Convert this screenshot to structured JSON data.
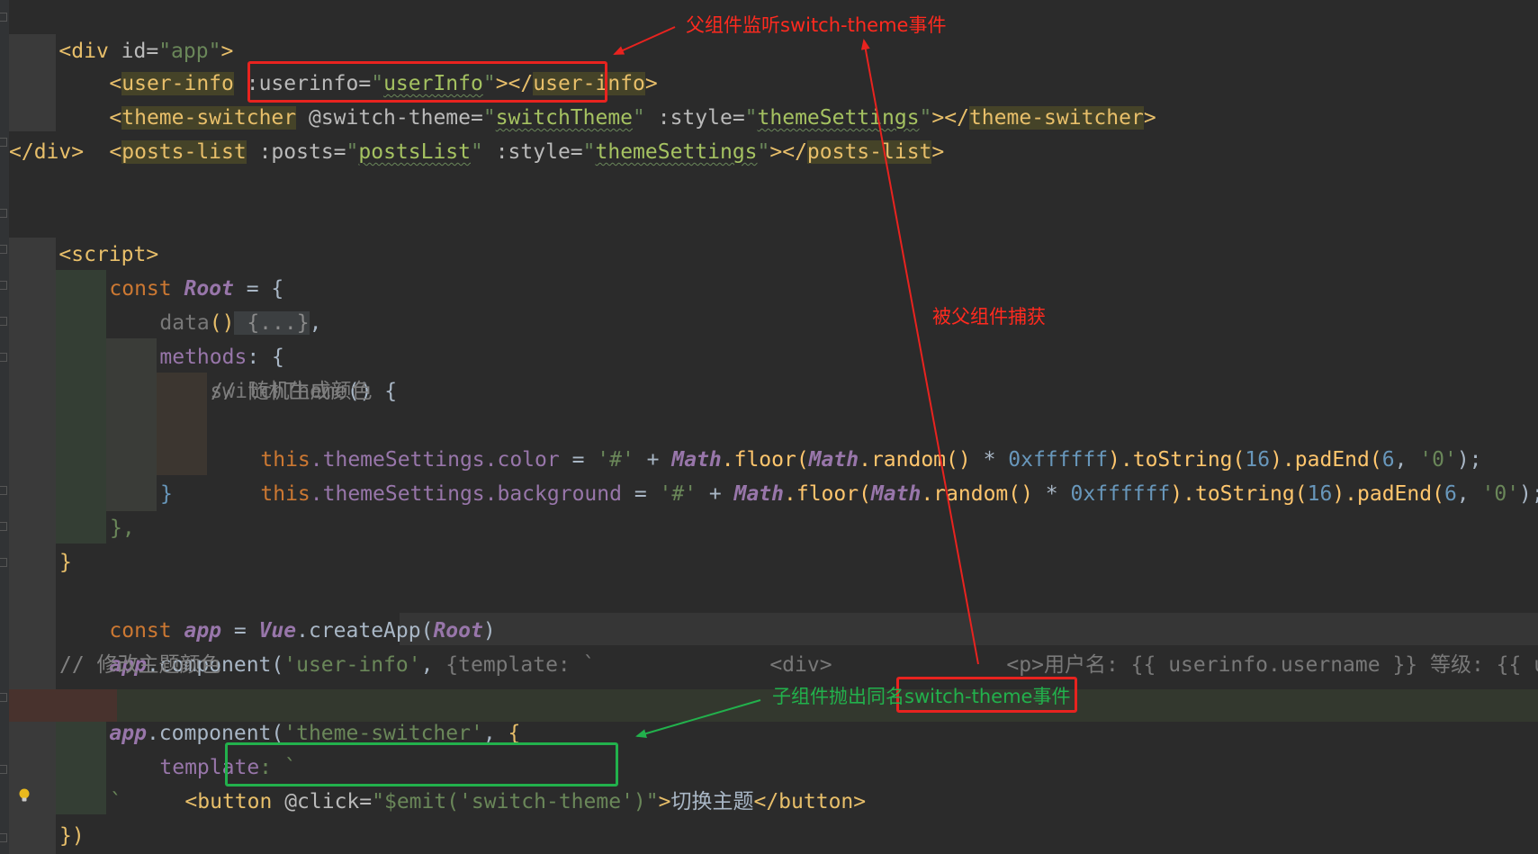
{
  "code": {
    "l1": {
      "open": "<",
      "tag": "div",
      "attr": " id=",
      "val": "\"app\"",
      "close": ">"
    },
    "l2": {
      "lt": "<",
      "tag": "user-info",
      "attr": " :userinfo=",
      "q1": "\"",
      "val": "userInfo",
      "q2": "\"",
      "mid": "></",
      "tag2": "user-info",
      "gt": ">"
    },
    "l3": {
      "lt": "<",
      "tag": "theme-switcher",
      "attr": " @switch-theme=",
      "q1": "\"",
      "val": "switchTheme",
      "q2": "\"",
      "attr2": " :style=",
      "q3": "\"",
      "val2": "themeSettings",
      "q4": "\"",
      "mid": "></",
      "tag2": "theme-switcher",
      "gt": ">"
    },
    "l4": {
      "lt": "<",
      "tag": "posts-list",
      "attr": " :posts=",
      "q1": "\"",
      "val": "postsList",
      "q2": "\"",
      "attr2": " :style=",
      "q3": "\"",
      "val2": "themeSettings",
      "q4": "\"",
      "mid": "></",
      "tag2": "posts-list",
      "gt": ">"
    },
    "l5": {
      "text": "</div>"
    },
    "l7": {
      "lt": "<",
      "tag": "script",
      "gt": ">"
    },
    "l8": {
      "kw": "const ",
      "name": "Root",
      "rest": " = {"
    },
    "l9": {
      "fn": "data",
      "paren": "()",
      "fold": " {...}",
      "comma": ","
    },
    "l10": {
      "fn": "methods",
      "rest": ": {"
    },
    "l11": {
      "fn": "switchTheme",
      "rest": "() {"
    },
    "l12": {
      "comment": "// 随机生成颜色"
    },
    "l13": {
      "this": "this",
      "p1": ".themeSettings.color",
      "eq": " = ",
      "s1": "'#'",
      "plus": " + ",
      "math1": "Math",
      "f1": ".floor(",
      "math2": "Math",
      "f2": ".random()",
      "mul": " * ",
      "hex": "0xffffff",
      "f3": ").toString(",
      "n16": "16",
      "f4": ").padEnd(",
      "n6": "6",
      "c": ", ",
      "s0": "'0'",
      "end": ");"
    },
    "l14": {
      "this": "this",
      "p1": ".themeSettings.background",
      "eq": " = ",
      "s1": "'#'",
      "plus": " + ",
      "math1": "Math",
      "f1": ".floor(",
      "math2": "Math",
      "f2": ".random()",
      "mul": " * ",
      "hex": "0xffffff",
      "f3": ").toString(",
      "n16": "16",
      "f4": ").padEnd(",
      "n6": "6",
      "c": ", ",
      "s0": "'0'",
      "end": ");"
    },
    "l15": {
      "text": "}"
    },
    "l16": {
      "text": "},"
    },
    "l17": {
      "text": "}"
    },
    "l18": {
      "kw": "const ",
      "name": "app",
      "eq": " = ",
      "vue": "Vue",
      "fn": ".createApp(",
      "root": "Root",
      "end": ")"
    },
    "l19": {
      "app": "app",
      "fn": ".component(",
      "s": "'user-info'",
      "c": ", ",
      "hint": "{template: `              <div>              <p>用户名: {{ userinfo.username }} 等级: {{ u"
    },
    "l20": {
      "comment": "// 修改主题颜色"
    },
    "l21": {
      "app": "app",
      "fn": ".component(",
      "s": "'theme-switcher'",
      "c": ", ",
      "b": "{"
    },
    "l22": {
      "key": "template",
      "rest": ": `"
    },
    "l23": {
      "lt": "<",
      "tag": "button",
      "attr": " @click=",
      "val": "\"$emit('switch-theme')\"",
      "gt": ">",
      "text": "切换主题",
      "close": "</button>"
    },
    "l24": {
      "text": "`"
    },
    "l25": {
      "text": "})"
    }
  },
  "annotations": {
    "top": "父组件监听switch-theme事件",
    "middle": "被父组件捕获",
    "bottom_prefix": "子组件抛出同名",
    "bottom_boxed": "switch-theme事件"
  },
  "colors": {
    "red": "#e8231f",
    "green": "#22b14c"
  }
}
